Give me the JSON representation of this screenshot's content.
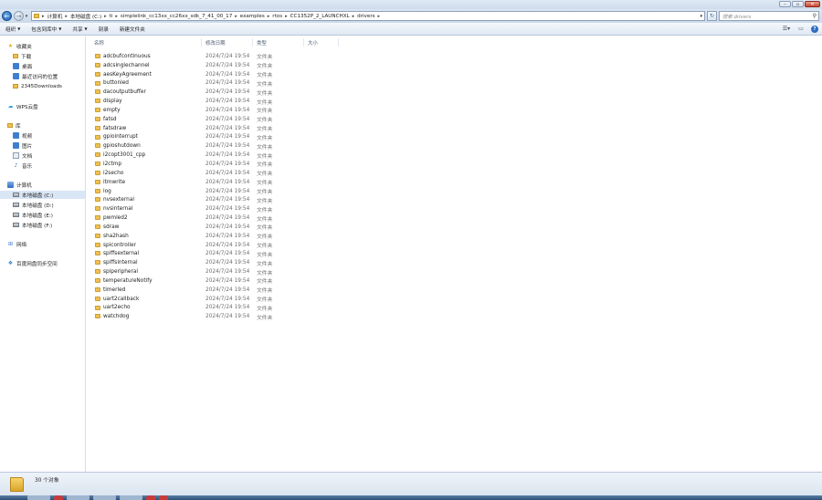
{
  "titlebar": {
    "buttons": [
      "minimize",
      "maximize",
      "close"
    ],
    "min_glyph": "–",
    "max_glyph": "▫",
    "close_glyph": "✕"
  },
  "address": {
    "breadcrumbs": [
      "计算机",
      "本地磁盘 (C:)",
      "ti",
      "simplelink_cc13xx_cc26xx_sdk_7_41_00_17",
      "examples",
      "rtos",
      "CC1352P_2_LAUNCHXL",
      "drivers"
    ],
    "search_placeholder": "搜索 drivers",
    "back_glyph": "←",
    "forward_glyph": "→",
    "refresh_glyph": "↻"
  },
  "toolbar": {
    "organize": "组织",
    "include_in_library": "包含到库中",
    "share": "共享",
    "burn": "刻录",
    "new_folder": "新建文件夹"
  },
  "sidebar": {
    "favorites": "收藏夹",
    "downloads": "下载",
    "desktop": "桌面",
    "recent": "最近访问的位置",
    "downloads2345": "2345Downloads",
    "wps": "WPS云盘",
    "libraries": "库",
    "videos": "视频",
    "pictures": "图片",
    "documents": "文档",
    "music": "音乐",
    "computer": "计算机",
    "drive_c": "本地磁盘 (C:)",
    "drive_d": "本地磁盘 (D:)",
    "drive_e": "本地磁盘 (E:)",
    "drive_f": "本地磁盘 (F:)",
    "network": "网络",
    "baidu": "百度网盘同步空间"
  },
  "columns": {
    "name": "名称",
    "modified": "修改日期",
    "type": "类型",
    "size": "大小"
  },
  "files": [
    {
      "name": "adcbufcontinuous",
      "date": "2024/7/24 19:54",
      "type": "文件夹"
    },
    {
      "name": "adcsinglechannel",
      "date": "2024/7/24 19:54",
      "type": "文件夹"
    },
    {
      "name": "aesKeyAgreement",
      "date": "2024/7/24 19:54",
      "type": "文件夹"
    },
    {
      "name": "buttonled",
      "date": "2024/7/24 19:54",
      "type": "文件夹"
    },
    {
      "name": "dacoutputbuffer",
      "date": "2024/7/24 19:54",
      "type": "文件夹"
    },
    {
      "name": "display",
      "date": "2024/7/24 19:54",
      "type": "文件夹"
    },
    {
      "name": "empty",
      "date": "2024/7/24 19:54",
      "type": "文件夹"
    },
    {
      "name": "fatsd",
      "date": "2024/7/24 19:54",
      "type": "文件夹"
    },
    {
      "name": "fatsdraw",
      "date": "2024/7/24 19:54",
      "type": "文件夹"
    },
    {
      "name": "gpiointerrupt",
      "date": "2024/7/24 19:54",
      "type": "文件夹"
    },
    {
      "name": "gpioshutdown",
      "date": "2024/7/24 19:54",
      "type": "文件夹"
    },
    {
      "name": "i2copt3001_cpp",
      "date": "2024/7/24 19:54",
      "type": "文件夹"
    },
    {
      "name": "i2ctmp",
      "date": "2024/7/24 19:54",
      "type": "文件夹"
    },
    {
      "name": "i2secho",
      "date": "2024/7/24 19:54",
      "type": "文件夹"
    },
    {
      "name": "itmwrite",
      "date": "2024/7/24 19:54",
      "type": "文件夹"
    },
    {
      "name": "log",
      "date": "2024/7/24 19:54",
      "type": "文件夹"
    },
    {
      "name": "nvsexternal",
      "date": "2024/7/24 19:54",
      "type": "文件夹"
    },
    {
      "name": "nvsinternal",
      "date": "2024/7/24 19:54",
      "type": "文件夹"
    },
    {
      "name": "pwmled2",
      "date": "2024/7/24 19:54",
      "type": "文件夹"
    },
    {
      "name": "sdraw",
      "date": "2024/7/24 19:54",
      "type": "文件夹"
    },
    {
      "name": "sha2hash",
      "date": "2024/7/24 19:54",
      "type": "文件夹"
    },
    {
      "name": "spicontroller",
      "date": "2024/7/24 19:54",
      "type": "文件夹"
    },
    {
      "name": "spiffsexternal",
      "date": "2024/7/24 19:54",
      "type": "文件夹"
    },
    {
      "name": "spiffsinternal",
      "date": "2024/7/24 19:54",
      "type": "文件夹"
    },
    {
      "name": "spiperipheral",
      "date": "2024/7/24 19:54",
      "type": "文件夹"
    },
    {
      "name": "temperatureNotify",
      "date": "2024/7/24 19:54",
      "type": "文件夹"
    },
    {
      "name": "timerled",
      "date": "2024/7/24 19:54",
      "type": "文件夹"
    },
    {
      "name": "uart2callback",
      "date": "2024/7/24 19:54",
      "type": "文件夹"
    },
    {
      "name": "uart2echo",
      "date": "2024/7/24 19:54",
      "type": "文件夹"
    },
    {
      "name": "watchdog",
      "date": "2024/7/24 19:54",
      "type": "文件夹"
    }
  ],
  "status": {
    "count": "30 个对象"
  }
}
